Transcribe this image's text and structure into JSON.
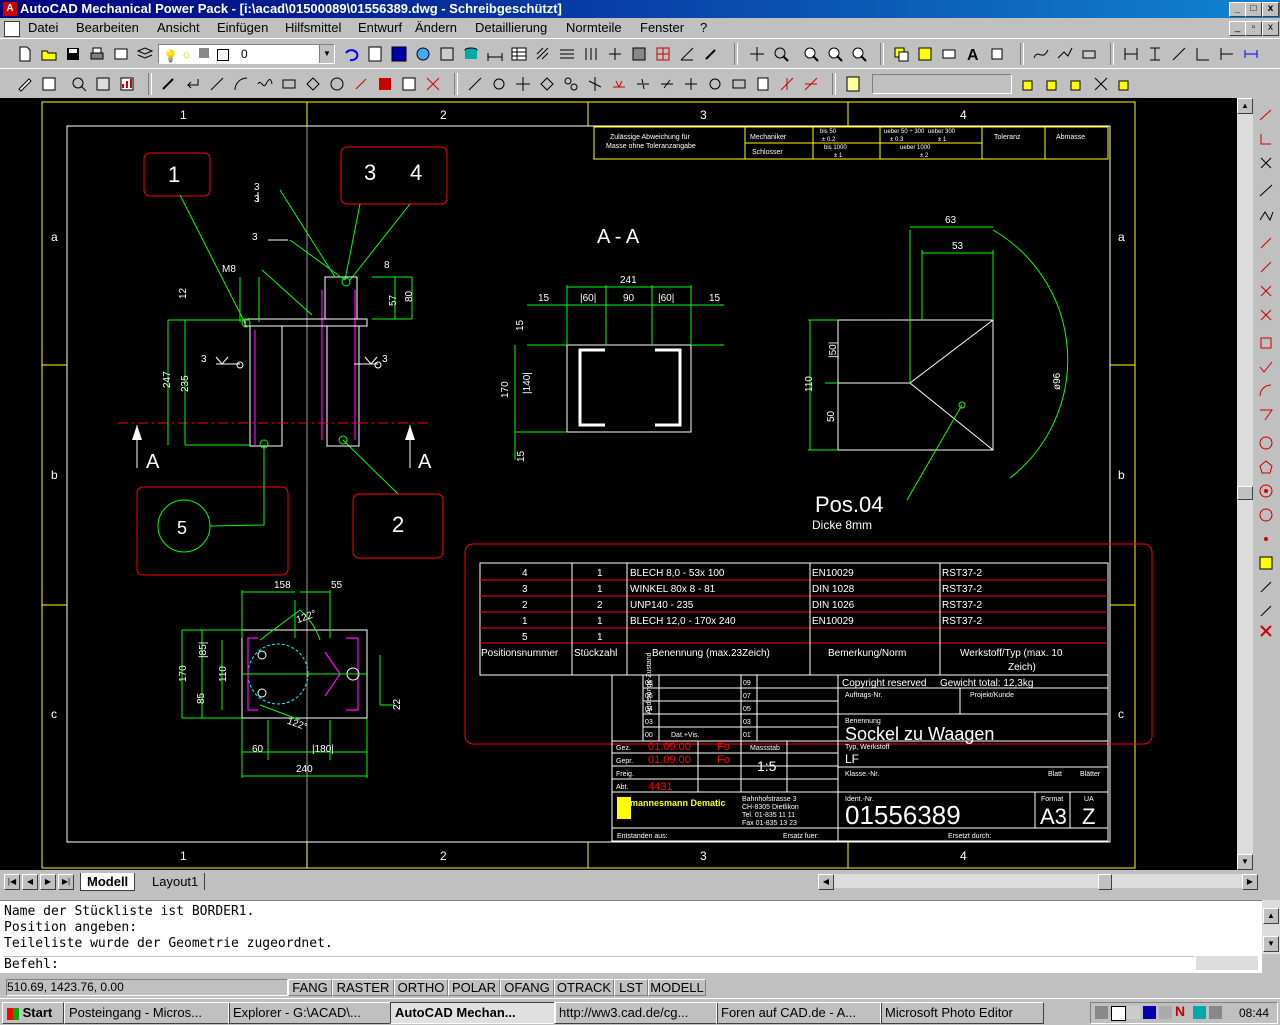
{
  "window": {
    "title": "AutoCAD Mechanical Power Pack - [i:\\acad\\01500089\\01556389.dwg - Schreibgeschützt]",
    "min": "_",
    "max": "□",
    "close": "x"
  },
  "menu": [
    "Datei",
    "Bearbeiten",
    "Ansicht",
    "Einfügen",
    "Hilfsmittel",
    "Entwurf",
    "Ändern",
    "Detaillierung",
    "Normteile",
    "Fenster",
    "?"
  ],
  "toolbar": {
    "layer_value": "0"
  },
  "drawing": {
    "frame_cols": [
      "1",
      "2",
      "3",
      "4"
    ],
    "frame_rows": [
      "a",
      "b",
      "c"
    ],
    "balloons": [
      "1",
      "3",
      "4",
      "5",
      "2"
    ],
    "section_labels": {
      "a_left": "A",
      "a_right": "A",
      "title": "A - A"
    },
    "dims_front": {
      "m8": "M8",
      "d12": "12",
      "d247": "247",
      "d235": "235",
      "d8": "8",
      "d57": "57",
      "d80": "80",
      "w3": "3"
    },
    "dims_section": {
      "d241": "241",
      "d15a": "15",
      "d60a": "|60|",
      "d90": "90",
      "d60b": "|60|",
      "d15b": "15",
      "d15c": "15",
      "d170": "170",
      "d140": "|140|",
      "d15d": "15"
    },
    "dims_pos04": {
      "d63": "63",
      "d53": "53",
      "d110": "110",
      "d50a": "|50|",
      "d50b": "50",
      "d96": "ø96",
      "title": "Pos.04",
      "thickness": "Dicke 8mm"
    },
    "dims_top": {
      "d158": "158",
      "d55": "55",
      "a122a": "122°",
      "a122b": "122°",
      "d170": "170",
      "d85a": "|85|",
      "d110": "110",
      "d85b": "85",
      "d22": "22",
      "d60": "60",
      "d180": "|180|",
      "d240": "240"
    },
    "tolerance": {
      "label1": "Zulässige Abweichung für",
      "label2": "Masse ohne Toleranzangabe",
      "row1": "Mechaniker",
      "row2": "Schlosser",
      "h1": "bis 50",
      "v1": "± 0.2",
      "h2": "ueber 50 ÷ 300",
      "v2": "± 0.3",
      "h3": "ueber 300",
      "v3": "± 1",
      "r2a": "bis 1000",
      "r2b": "± 1",
      "r2c": "ueber 1000",
      "r2d": "± 2",
      "col_tol": "Toleranz",
      "col_abm": "Abmasse"
    },
    "bom": {
      "rows": [
        [
          "4",
          "1",
          "BLECH 8,0 - 53x 100",
          "EN10029",
          "RST37-2"
        ],
        [
          "3",
          "1",
          "WINKEL 80x 8 - 81",
          "DIN 1028",
          "RST37-2"
        ],
        [
          "2",
          "2",
          "UNP140 - 235",
          "DIN 1026",
          "RST37-2"
        ],
        [
          "1",
          "1",
          "BLECH 12,0 - 170x 240",
          "EN10029",
          "RST37-2"
        ],
        [
          "5",
          "1",
          "",
          "",
          ""
        ]
      ],
      "headers": [
        "Positionsnummer",
        "Stückzahl",
        "Benennung (max.23Zeich)",
        "Bemerkung/Norm",
        "Werkstoff/Typ (max. 10",
        "Zeich)"
      ]
    },
    "titleblock": {
      "rev_nums_l": [
        "08",
        "06",
        "04",
        "03",
        "00"
      ],
      "rev_nums_r": [
        "09",
        "07",
        "05",
        "03",
        "01"
      ],
      "aenderung": "Änderungs-Zustand",
      "dat_vis": "Dat.+Vis.",
      "copyright": "Copyright reserved",
      "weight": "Gewicht total: 12,3kg",
      "auftrags": "Auftrags-Nr.",
      "projekt": "Projekt/Kunde",
      "benennung_label": "Benennung",
      "benennung": "Sockel zu Waagen",
      "gez": "Gez.",
      "gez_date": "01.09.00",
      "gez_name": "Fo",
      "gepr": "Gepr.",
      "gepr_date": "01.09.00",
      "gepr_name": "Fo",
      "freig": "Freig.",
      "abt": "Abt.",
      "abt_val": "4431",
      "massstab_label": "Massstab",
      "massstab": "1:5",
      "typ_label": "Typ, Werkstoff",
      "typ": "LF",
      "klasse": "Klasse.-Nr.",
      "blatt": "Blatt",
      "blaetter": "Blätter",
      "company": "mannesmann Dematic",
      "address1": "Bahnhofstrasse 3",
      "address2": "CH-8305 Dietlikon",
      "address3": "Tel. 01-835 11 11",
      "address4": "Fax 01-835 13 23",
      "ident_label": "Ident.-Nr.",
      "ident": "01556389",
      "format_label": "Format",
      "format": "A3",
      "ua_label": "UA",
      "ua": "Z",
      "entstanden": "Entstanden aus:",
      "ersatz_fuer": "Ersatz fuer:",
      "ersetzt": "Ersetzt durch:"
    }
  },
  "tabs": {
    "model": "Modell",
    "layout": "Layout1"
  },
  "command": {
    "line1": "Name der Stückliste ist BORDER1.",
    "line2": "Position angeben:",
    "line3": "Teileliste wurde der Geometrie zugeordnet.",
    "prompt": "Befehl:"
  },
  "status": {
    "coords": "510.69, 1423.76, 0.00",
    "modes": [
      "FANG",
      "RASTER",
      "ORTHO",
      "POLAR",
      "OFANG",
      "OTRACK",
      "LST",
      "MODELL"
    ]
  },
  "taskbar": {
    "start": "Start",
    "tasks": [
      "Posteingang - Micros...",
      "Explorer - G:\\ACAD\\...",
      "AutoCAD Mechan...",
      "http://ww3.cad.de/cg...",
      "Foren auf CAD.de - A...",
      "Microsoft Photo Editor"
    ],
    "clock": "08:44"
  },
  "colors": {
    "green": "#00ff00",
    "red": "#ff0000",
    "yellow": "#ffff00",
    "white": "#ffffff",
    "magenta": "#ff00ff",
    "cyan": "#00ffff"
  }
}
